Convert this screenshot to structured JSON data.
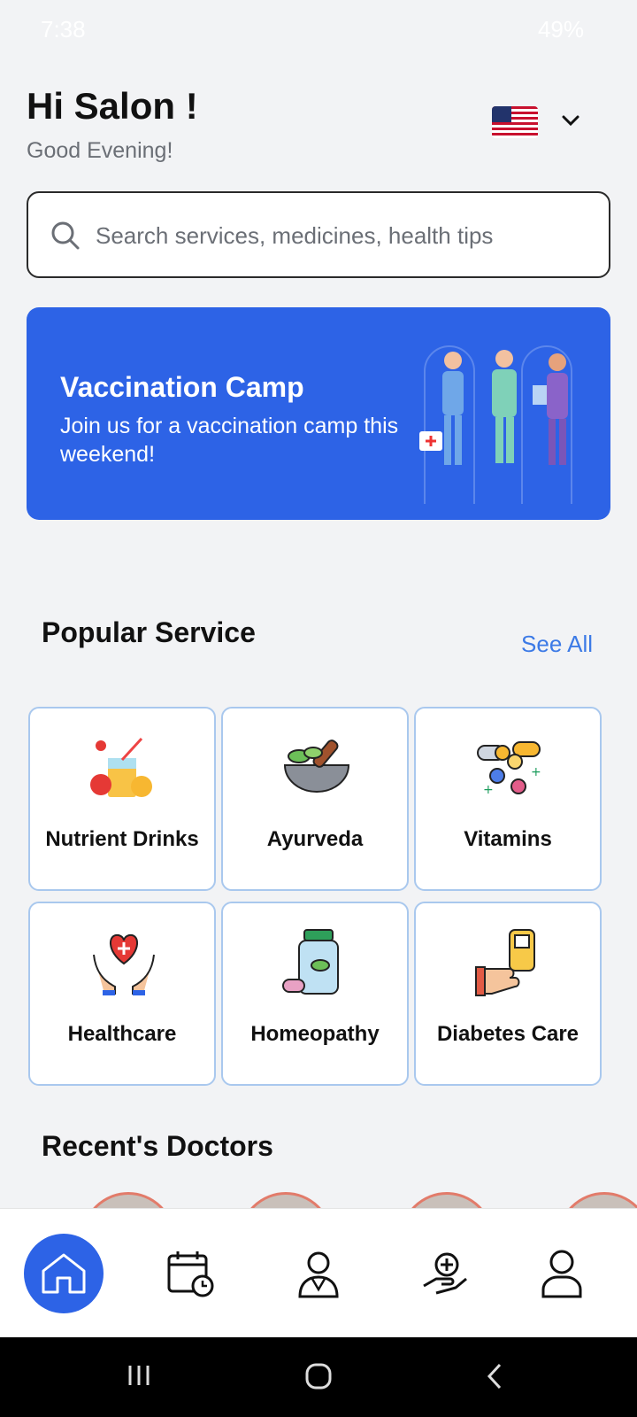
{
  "status_bar": {
    "time": "7:38",
    "battery": "49%"
  },
  "header": {
    "greeting": "Hi Salon !",
    "subtitle": "Good Evening!"
  },
  "language": {
    "flag_icon": "us-flag-icon"
  },
  "search": {
    "placeholder": "Search services, medicines, health tips"
  },
  "banner": {
    "title": "Vaccination Camp",
    "text": "Join us for a vaccination camp this weekend!",
    "color": "#2d63e6"
  },
  "popular": {
    "title": "Popular Service",
    "see_all": "See All",
    "services": [
      {
        "label": "Nutrient Drinks",
        "icon": "juice-glass-icon"
      },
      {
        "label": "Ayurveda",
        "icon": "mortar-pestle-icon"
      },
      {
        "label": "Vitamins",
        "icon": "vitamin-pills-icon"
      },
      {
        "label": "Healthcare",
        "icon": "heart-hands-icon"
      },
      {
        "label": "Homeopathy",
        "icon": "medicine-jar-icon"
      },
      {
        "label": "Diabetes Care",
        "icon": "glucose-meter-icon"
      }
    ]
  },
  "recent_doctors": {
    "title": "Recent's Doctors"
  },
  "bottom_nav": {
    "items": [
      {
        "icon": "home-icon",
        "active": true
      },
      {
        "icon": "calendar-clock-icon",
        "active": false
      },
      {
        "icon": "doctor-icon",
        "active": false
      },
      {
        "icon": "medical-care-hand-icon",
        "active": false
      },
      {
        "icon": "profile-icon",
        "active": false
      }
    ]
  },
  "colors": {
    "accent": "#2d63e6",
    "link": "#3c7ae6",
    "card_border": "#a9c8ee"
  }
}
